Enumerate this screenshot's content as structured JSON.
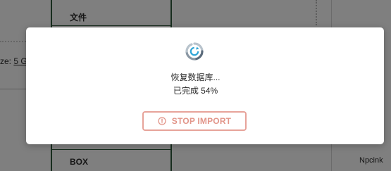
{
  "background": {
    "column_header": "文件",
    "row_label": "BOX",
    "size_prefix": "ze: ",
    "size_value": "5 G",
    "user_name": "Npcink"
  },
  "dialog": {
    "title": "恢复数据库...",
    "progress_text": "已完成 54%",
    "progress_percent": 54,
    "stop_button_label": "STOP IMPORT",
    "spinner_icon": "refresh-spinner-icon",
    "stop_icon": "alert-circle-icon"
  },
  "colors": {
    "spinner_light": "#b8c3cc",
    "spinner_dark": "#5b6b7b",
    "spinner_accent": "#2ea5d6",
    "stop_accent": "#e29589"
  }
}
